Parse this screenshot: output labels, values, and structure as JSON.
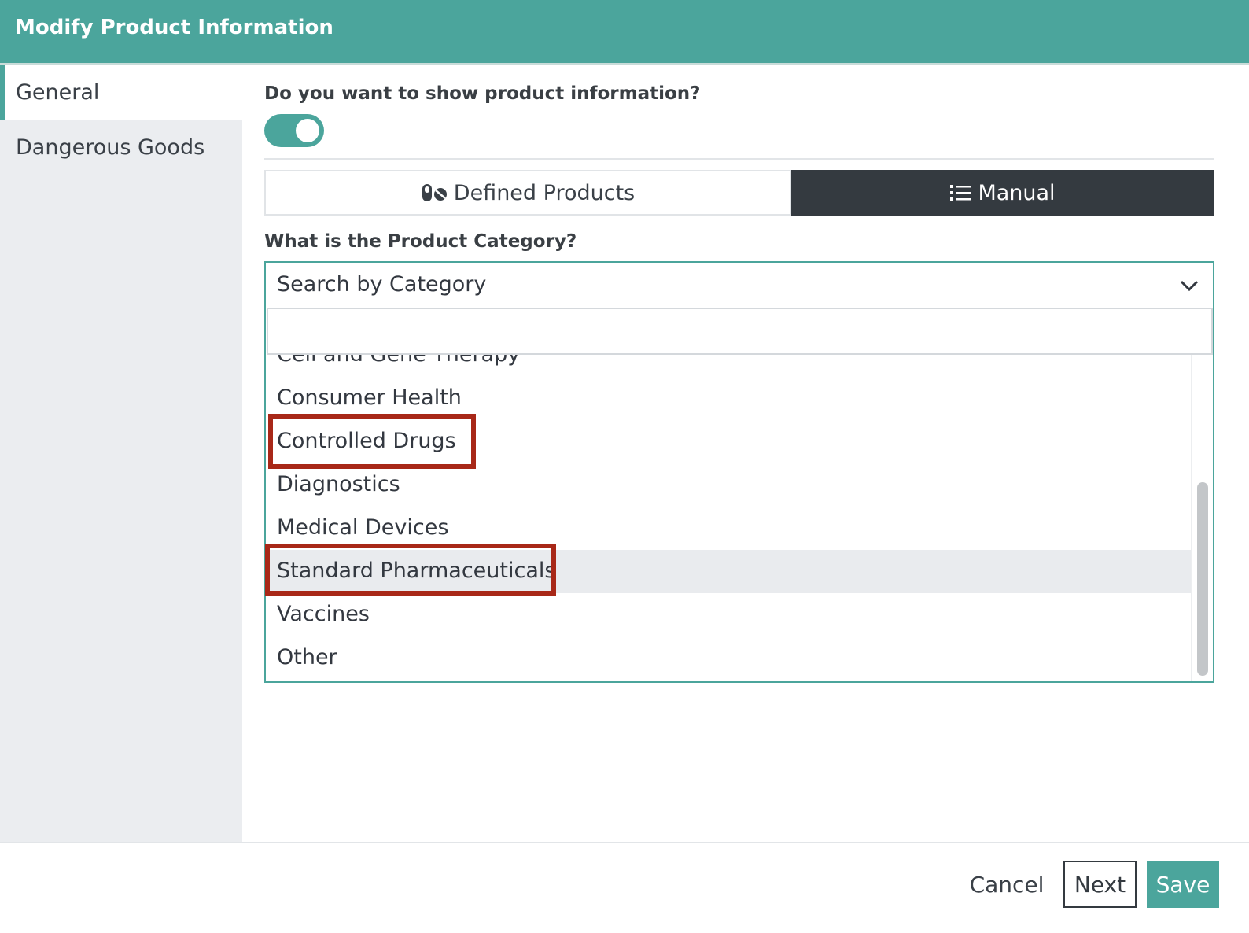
{
  "dialog": {
    "title": "Modify Product Information"
  },
  "sidebar": {
    "items": [
      {
        "label": "General",
        "active": true
      },
      {
        "label": "Dangerous Goods",
        "active": false
      }
    ]
  },
  "general": {
    "show_question": "Do you want to show product information?",
    "show_toggle_on": true,
    "mode_tabs": [
      {
        "label": "Defined Products",
        "icon": "pills-icon",
        "selected": false
      },
      {
        "label": "Manual",
        "icon": "list-icon",
        "selected": true
      }
    ],
    "category_question": "What is the Product Category?",
    "category_select": {
      "value": "Search by Category",
      "search_value": "",
      "options": [
        "Cell and Gene Therapy",
        "Consumer Health",
        "Controlled Drugs",
        "Diagnostics",
        "Medical Devices",
        "Standard Pharmaceuticals",
        "Vaccines",
        "Other"
      ],
      "highlighted_option": "Standard Pharmaceuticals",
      "annotated_options": [
        "Controlled Drugs",
        "Standard Pharmaceuticals"
      ]
    }
  },
  "footer": {
    "cancel_label": "Cancel",
    "next_label": "Next",
    "save_label": "Save"
  },
  "colors": {
    "accent": "#4ba59c",
    "dark": "#343a40",
    "annotation": "#a82818"
  }
}
